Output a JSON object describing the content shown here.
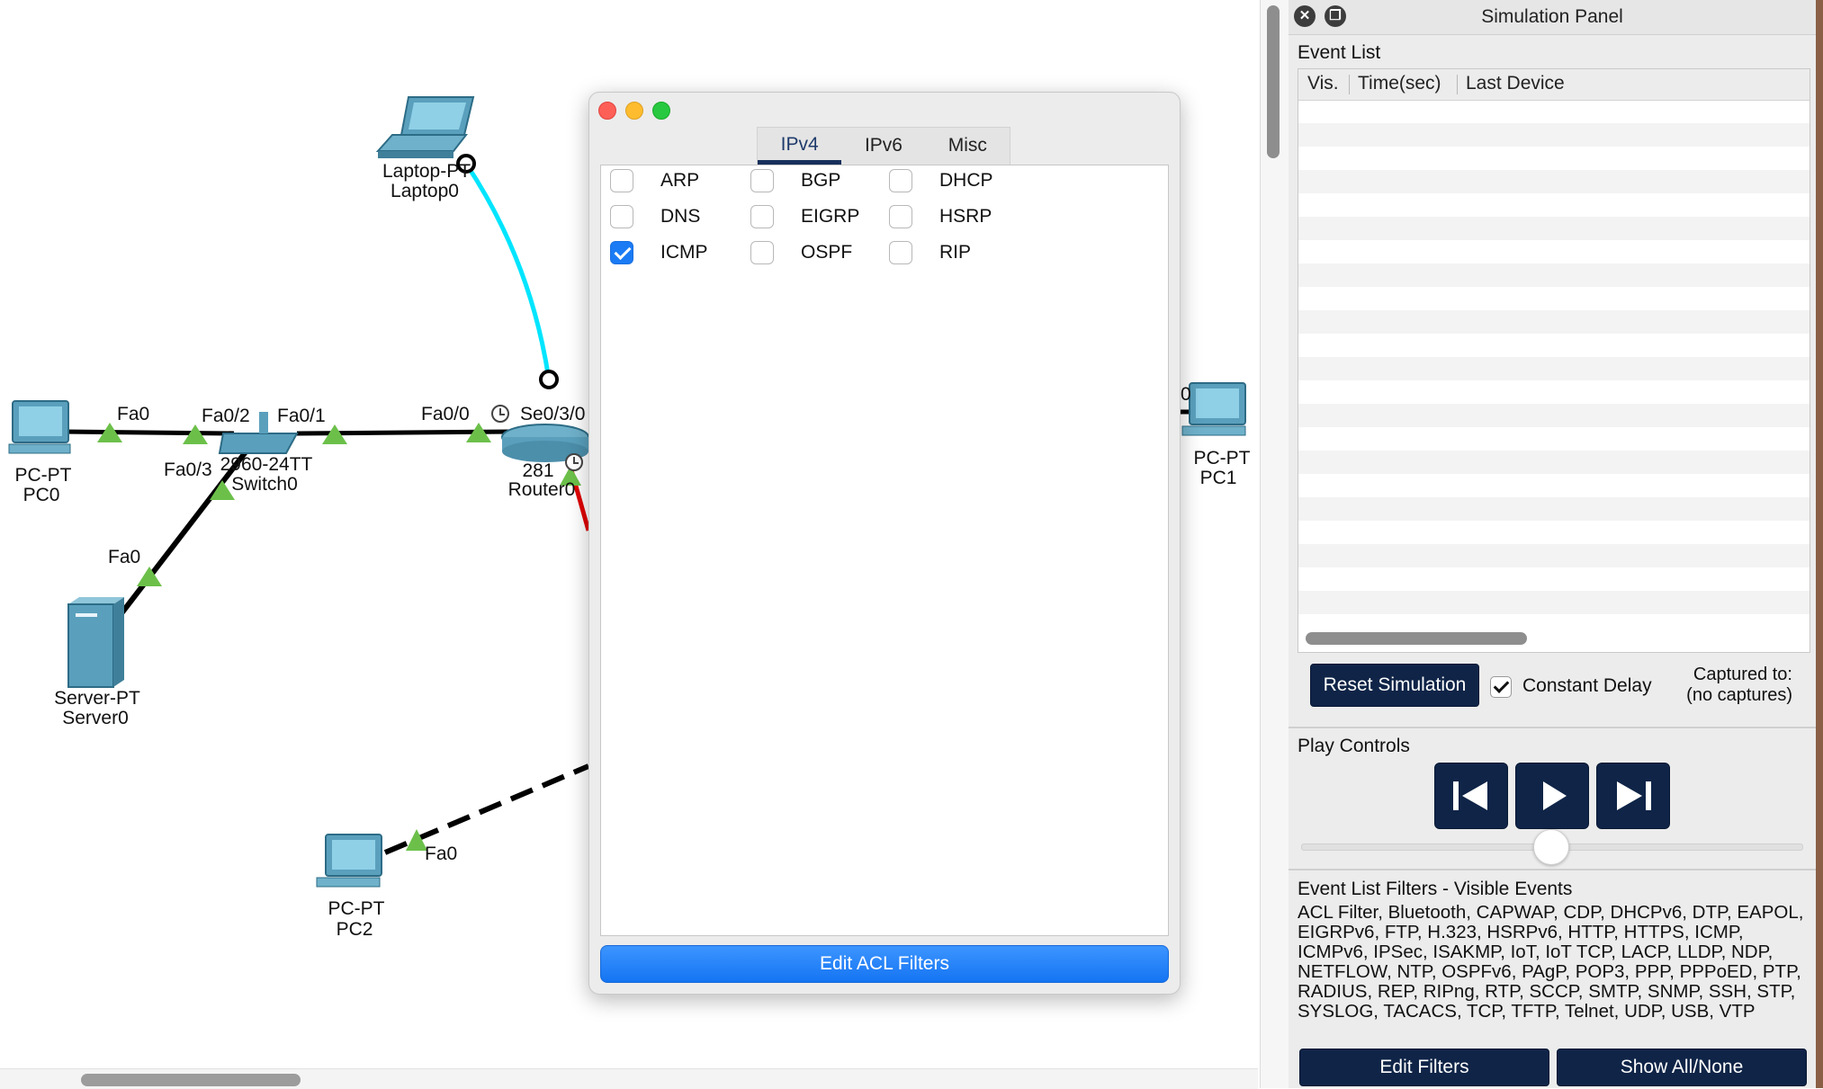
{
  "topology": {
    "devices": {
      "laptop0": {
        "model": "Laptop-PT",
        "name": "Laptop0"
      },
      "pc0": {
        "model": "PC-PT",
        "name": "PC0"
      },
      "switch0": {
        "model": "2960-24TT",
        "name": "Switch0"
      },
      "router0": {
        "model": "281",
        "name": "Router0"
      },
      "server0": {
        "model": "Server-PT",
        "name": "Server0"
      },
      "pc1": {
        "model": "PC-PT",
        "name": "PC1"
      },
      "pc2": {
        "model": "PC-PT",
        "name": "PC2"
      }
    },
    "ports": {
      "pc0_fa0": "Fa0",
      "sw_fa0_2": "Fa0/2",
      "sw_fa0_1": "Fa0/1",
      "sw_fa0_3": "Fa0/3",
      "rt_fa0_0": "Fa0/0",
      "rt_se0_3_0": "Se0/3/0",
      "server_fa0": "Fa0",
      "pc2_fa0": "Fa0",
      "pc1_port": "0"
    },
    "link_colors": {
      "ethernet": "#000000",
      "console": "#00e5ff",
      "serial": "#e00000",
      "link_up": "#6cc04a"
    }
  },
  "filter_dialog": {
    "tabs": [
      {
        "label": "IPv4",
        "active": true
      },
      {
        "label": "IPv6",
        "active": false
      },
      {
        "label": "Misc",
        "active": false
      }
    ],
    "protocols": [
      {
        "label": "ARP",
        "checked": false
      },
      {
        "label": "BGP",
        "checked": false
      },
      {
        "label": "DHCP",
        "checked": false
      },
      {
        "label": "DNS",
        "checked": false
      },
      {
        "label": "EIGRP",
        "checked": false
      },
      {
        "label": "HSRP",
        "checked": false
      },
      {
        "label": "ICMP",
        "checked": true
      },
      {
        "label": "OSPF",
        "checked": false
      },
      {
        "label": "RIP",
        "checked": false
      }
    ],
    "edit_acl_label": "Edit ACL Filters"
  },
  "sim_panel": {
    "title": "Simulation Panel",
    "event_list_title": "Event List",
    "columns": [
      "Vis.",
      "Time(sec)",
      "Last Device"
    ],
    "reset_label": "Reset Simulation",
    "constant_delay_label": "Constant Delay",
    "constant_delay_checked": true,
    "captured_line1": "Captured to:",
    "captured_line2": "(no captures)",
    "play_controls_title": "Play Controls",
    "filters_title": "Event List Filters - Visible Events",
    "filters_text": "ACL Filter, Bluetooth, CAPWAP, CDP, DHCPv6, DTP, EAPOL, EIGRPv6, FTP, H.323, HSRPv6, HTTP, HTTPS, ICMP, ICMPv6, IPSec, ISAKMP, IoT, IoT TCP, LACP, LLDP, NDP, NETFLOW, NTP, OSPFv6, PAgP, POP3, PPP, PPPoED, PTP, RADIUS, REP, RIPng, RTP, SCCP, SMTP, SNMP, SSH, STP, SYSLOG, TACACS, TCP, TFTP, Telnet, UDP, USB, VTP",
    "edit_filters_label": "Edit Filters",
    "show_all_label": "Show All/None"
  }
}
